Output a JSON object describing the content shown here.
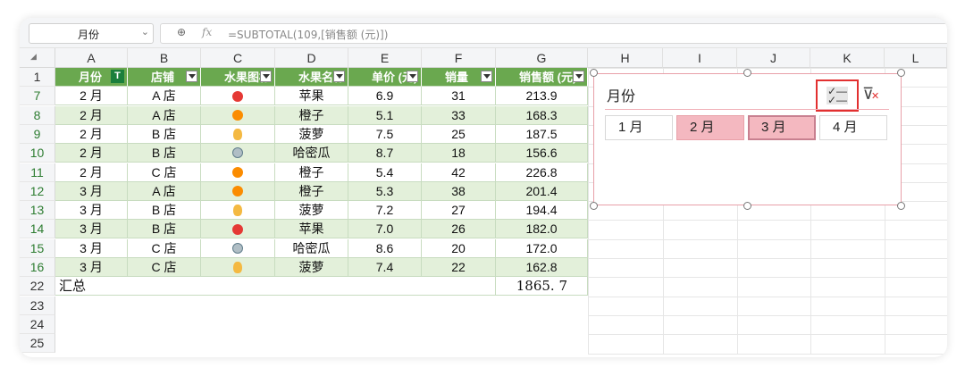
{
  "name_box": "月份",
  "formula": {
    "zoom_icon": "zoom-icon",
    "fx_label": "fx",
    "text": "=SUBTOTAL(109,[销售额 (元)])"
  },
  "columns": [
    "A",
    "B",
    "C",
    "D",
    "E",
    "F",
    "G",
    "H",
    "I",
    "J",
    "K",
    "L"
  ],
  "headers": [
    "月份",
    "店铺",
    "水果图标",
    "水果名称",
    "单价 (元)",
    "销量",
    "销售额 (元)"
  ],
  "filter_active_icon": "T",
  "rows": [
    {
      "num": "7",
      "month": "2 月",
      "store": "A 店",
      "icon": "apple",
      "fruit": "苹果",
      "price": "6.9",
      "qty": "31",
      "sales": "213.9"
    },
    {
      "num": "8",
      "month": "2 月",
      "store": "A 店",
      "icon": "orange",
      "fruit": "橙子",
      "price": "5.1",
      "qty": "33",
      "sales": "168.3"
    },
    {
      "num": "9",
      "month": "2 月",
      "store": "B 店",
      "icon": "pineapple",
      "fruit": "菠萝",
      "price": "7.5",
      "qty": "25",
      "sales": "187.5"
    },
    {
      "num": "10",
      "month": "2 月",
      "store": "B 店",
      "icon": "melon",
      "fruit": "哈密瓜",
      "price": "8.7",
      "qty": "18",
      "sales": "156.6"
    },
    {
      "num": "11",
      "month": "2 月",
      "store": "C 店",
      "icon": "orange",
      "fruit": "橙子",
      "price": "5.4",
      "qty": "42",
      "sales": "226.8"
    },
    {
      "num": "12",
      "month": "3 月",
      "store": "A 店",
      "icon": "orange",
      "fruit": "橙子",
      "price": "5.3",
      "qty": "38",
      "sales": "201.4"
    },
    {
      "num": "13",
      "month": "3 月",
      "store": "B 店",
      "icon": "pineapple",
      "fruit": "菠萝",
      "price": "7.2",
      "qty": "27",
      "sales": "194.4"
    },
    {
      "num": "14",
      "month": "3 月",
      "store": "B 店",
      "icon": "apple",
      "fruit": "苹果",
      "price": "7.0",
      "qty": "26",
      "sales": "182.0"
    },
    {
      "num": "15",
      "month": "3 月",
      "store": "C 店",
      "icon": "melon",
      "fruit": "哈密瓜",
      "price": "8.6",
      "qty": "20",
      "sales": "172.0"
    },
    {
      "num": "16",
      "month": "3 月",
      "store": "C 店",
      "icon": "pineapple",
      "fruit": "菠萝",
      "price": "7.4",
      "qty": "22",
      "sales": "162.8"
    }
  ],
  "header_row_num": "1",
  "total": {
    "num": "22",
    "label": "汇总",
    "value": "1865. 7"
  },
  "extra_rows": [
    "23",
    "24",
    "25"
  ],
  "slicer": {
    "title": "月份",
    "items": [
      {
        "label": "1 月",
        "selected": false
      },
      {
        "label": "2 月",
        "selected": true
      },
      {
        "label": "3 月",
        "selected": true
      },
      {
        "label": "4 月",
        "selected": false
      }
    ],
    "multi_select_icon": "multi-select-icon",
    "clear_filter_icon": "clear-filter-icon"
  }
}
